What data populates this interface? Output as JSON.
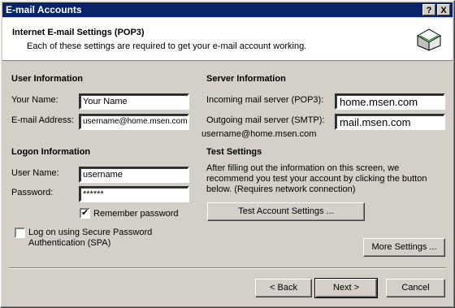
{
  "window": {
    "title": "E-mail Accounts",
    "help_button": "?",
    "close_button": "X"
  },
  "header": {
    "title": "Internet E-mail Settings (POP3)",
    "subtitle": "Each of these settings are required to get your e-mail account working."
  },
  "user_info": {
    "heading": "User Information",
    "your_name_label": "Your Name:",
    "your_name_value": "Your Name",
    "email_label": "E-mail Address:",
    "email_value": "username@home.msen.com"
  },
  "server_info": {
    "heading": "Server Information",
    "incoming_label": "Incoming mail server (POP3):",
    "incoming_value": "home.msen.com",
    "outgoing_label": "Outgoing mail server (SMTP):",
    "outgoing_value": "mail.msen.com",
    "annotation": "username@home.msen.com"
  },
  "logon_info": {
    "heading": "Logon Information",
    "user_name_label": "User Name:",
    "user_name_value": "username",
    "password_label": "Password:",
    "password_value": "******",
    "remember_label": "Remember password",
    "remember_checked": "✔",
    "spa_label_line1": "Log on using Secure Password",
    "spa_label_line2": "Authentication (SPA)"
  },
  "test_settings": {
    "heading": "Test Settings",
    "text_line1": "After filling out the information on this screen, we",
    "text_line2": "recommend you test your account by clicking the button",
    "text_line3": "below. (Requires network connection)",
    "button_label": "Test Account Settings ..."
  },
  "more_settings_label": "More Settings ...",
  "footer": {
    "back_label": "< Back",
    "next_label": "Next >",
    "cancel_label": "Cancel"
  }
}
